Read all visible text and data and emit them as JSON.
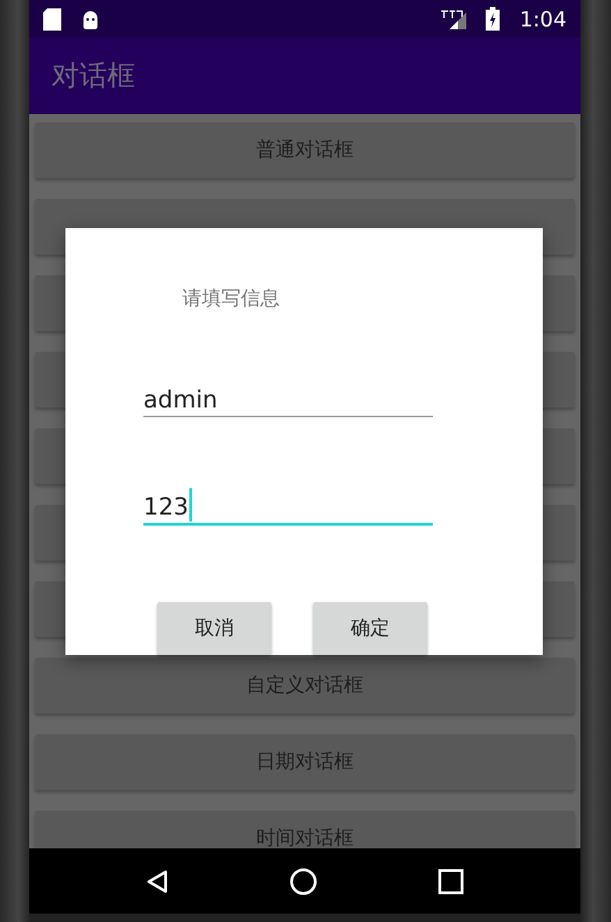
{
  "status_bar": {
    "time": "1:04"
  },
  "app_bar": {
    "title": "对话框"
  },
  "buttons": [
    {
      "kind": "button",
      "label": "普通对话框"
    },
    {
      "kind": "button"
    },
    {
      "kind": "button"
    },
    {
      "kind": "button"
    },
    {
      "kind": "button"
    },
    {
      "kind": "button"
    },
    {
      "kind": "button"
    },
    {
      "kind": "button",
      "label": "自定义对话框"
    },
    {
      "kind": "button",
      "label": "日期对话框"
    },
    {
      "kind": "button",
      "label": "时间对话框"
    }
  ],
  "dialog": {
    "title": "请填写信息",
    "fields": [
      {
        "value": "admin",
        "focused": false
      },
      {
        "value": "123",
        "focused": true
      }
    ],
    "actions": [
      "取消",
      "确定"
    ]
  }
}
